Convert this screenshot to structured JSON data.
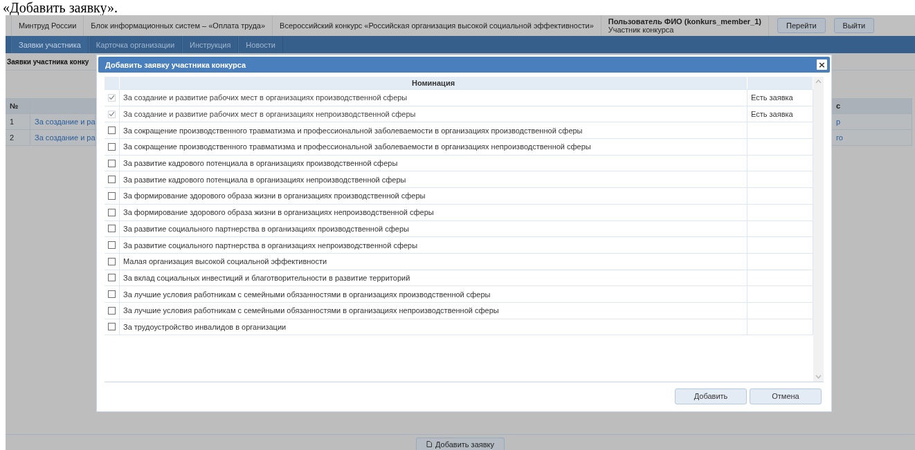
{
  "document_text": "«Добавить заявку».",
  "header": {
    "items": [
      "Минтруд России",
      "Блок информационных систем – «Оплата труда»",
      "Всероссийский конкурс «Российская организация высокой социальной эффективности»"
    ],
    "user": {
      "name": "Пользователь ФИО (konkurs_member_1)",
      "role": "Участник конкурса"
    },
    "buttons": [
      "Перейти",
      "Выйти"
    ]
  },
  "nav": [
    {
      "label": "Заявки участника",
      "selected": true
    },
    {
      "label": "Карточка организации",
      "selected": false
    },
    {
      "label": "Инструкция",
      "selected": false
    },
    {
      "label": "Новости",
      "selected": false
    }
  ],
  "page_title": "Заявки участника конку",
  "background_table": {
    "columns": [
      "№",
      "",
      "с"
    ],
    "rows": [
      [
        "1",
        "За создание и ра",
        "р"
      ],
      [
        "2",
        "За создание и ра",
        "го"
      ]
    ]
  },
  "add_button": "Добавить заявку",
  "dialog": {
    "title": "Добавить заявку участника конкурса",
    "close": "×",
    "columns": [
      "Номинация",
      ""
    ],
    "rows": [
      {
        "checked": true,
        "disabled": true,
        "nomination": "За создание и развитие рабочих мест в организациях производственной сферы",
        "status": "Есть заявка"
      },
      {
        "checked": true,
        "disabled": true,
        "nomination": "За создание и развитие рабочих мест в организациях непроизводственной сферы",
        "status": "Есть заявка"
      },
      {
        "checked": false,
        "disabled": false,
        "nomination": "За сокращение производственного травматизма и профессиональной заболеваемости в организациях производственной сферы"
      },
      {
        "checked": false,
        "disabled": false,
        "nomination": "За сокращение производственного травматизма и профессиональной заболеваемости в организациях непроизводственной сферы"
      },
      {
        "checked": false,
        "disabled": false,
        "nomination": "За развитие кадрового потенциала в организациях производственной сферы"
      },
      {
        "checked": false,
        "disabled": false,
        "nomination": "За развитие кадрового потенциала в организациях непроизводственной сферы"
      },
      {
        "checked": false,
        "disabled": false,
        "nomination": "За формирование здорового образа жизни в организациях производственной сферы"
      },
      {
        "checked": false,
        "disabled": false,
        "nomination": "За формирование здорового образа жизни в организациях непроизводственной сферы"
      },
      {
        "checked": false,
        "disabled": false,
        "nomination": "За развитие социального партнерства в организациях производственной сферы"
      },
      {
        "checked": false,
        "disabled": false,
        "nomination": "За развитие социального партнерства в организациях непроизводственной сферы"
      },
      {
        "checked": false,
        "disabled": false,
        "nomination": "Малая организация высокой социальной эффективности"
      },
      {
        "checked": false,
        "disabled": false,
        "nomination": "За вклад социальных инвестиций и благотворительности в развитие территорий"
      },
      {
        "checked": false,
        "disabled": false,
        "nomination": "За лучшие условия работникам с семейными обязанностями в организациях производственной сферы"
      },
      {
        "checked": false,
        "disabled": false,
        "nomination": "За лучшие условия работникам с семейными обязанностями в организациях непроизводственной сферы"
      },
      {
        "checked": false,
        "disabled": false,
        "nomination": "За трудоустройство инвалидов в организации"
      }
    ],
    "buttons": [
      "Добавить",
      "Отмена"
    ]
  }
}
